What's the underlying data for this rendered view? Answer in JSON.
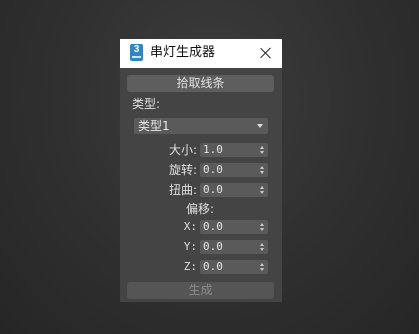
{
  "dialog": {
    "title": "串灯生成器",
    "app_icon_number": "3",
    "pick_button": "拾取线条",
    "type_label": "类型:",
    "type_select": "类型1",
    "size_label": "大小:",
    "size_value": "1.0",
    "rotate_label": "旋转:",
    "rotate_value": "0.0",
    "twist_label": "扭曲:",
    "twist_value": "0.0",
    "offset_label": "偏移:",
    "x_label": "X:",
    "x_value": "0.0",
    "y_label": "Y:",
    "y_value": "0.0",
    "z_label": "Z:",
    "z_value": "0.0",
    "generate_button": "生成"
  },
  "colors": {
    "panel_bg": "#444444",
    "control_bg": "#5a5a5a",
    "title_bg": "#ffffff",
    "icon_blue": "#2f86c8"
  }
}
